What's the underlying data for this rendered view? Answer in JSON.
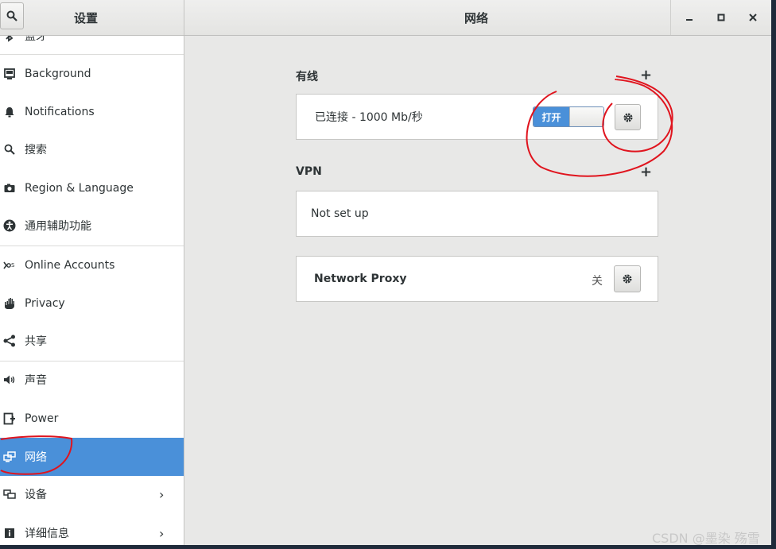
{
  "header": {
    "sidebar_title": "设置",
    "main_title": "网络",
    "minimize": "–",
    "maximize": "□",
    "close": "✕"
  },
  "sidebar": {
    "partial_item": "蓝牙",
    "items": [
      {
        "label": "Background",
        "icon": "background-icon"
      },
      {
        "label": "Notifications",
        "icon": "bell-icon"
      },
      {
        "label": "搜索",
        "icon": "search-icon"
      },
      {
        "label": "Region & Language",
        "icon": "camera-icon"
      },
      {
        "label": "通用辅助功能",
        "icon": "accessibility-icon"
      },
      {
        "label": "Online Accounts",
        "icon": "online-accounts-icon"
      },
      {
        "label": "Privacy",
        "icon": "hand-icon"
      },
      {
        "label": "共享",
        "icon": "share-icon"
      },
      {
        "label": "声音",
        "icon": "speaker-icon"
      },
      {
        "label": "Power",
        "icon": "power-icon"
      },
      {
        "label": "网络",
        "icon": "network-icon",
        "selected": true
      },
      {
        "label": "设备",
        "icon": "devices-icon",
        "chevron": "›"
      },
      {
        "label": "详细信息",
        "icon": "info-icon",
        "chevron": "›"
      }
    ]
  },
  "main": {
    "wired": {
      "title": "有线",
      "add": "+",
      "status": "已连接 - 1000 Mb/秒",
      "toggle_on_label": "打开"
    },
    "vpn": {
      "title": "VPN",
      "add": "+",
      "status": "Not set up"
    },
    "proxy": {
      "label": "Network Proxy",
      "state": "关"
    }
  },
  "watermark": "CSDN @墨染 殇雪",
  "colors": {
    "accent": "#4a90d9",
    "annotation": "#e0141e"
  }
}
